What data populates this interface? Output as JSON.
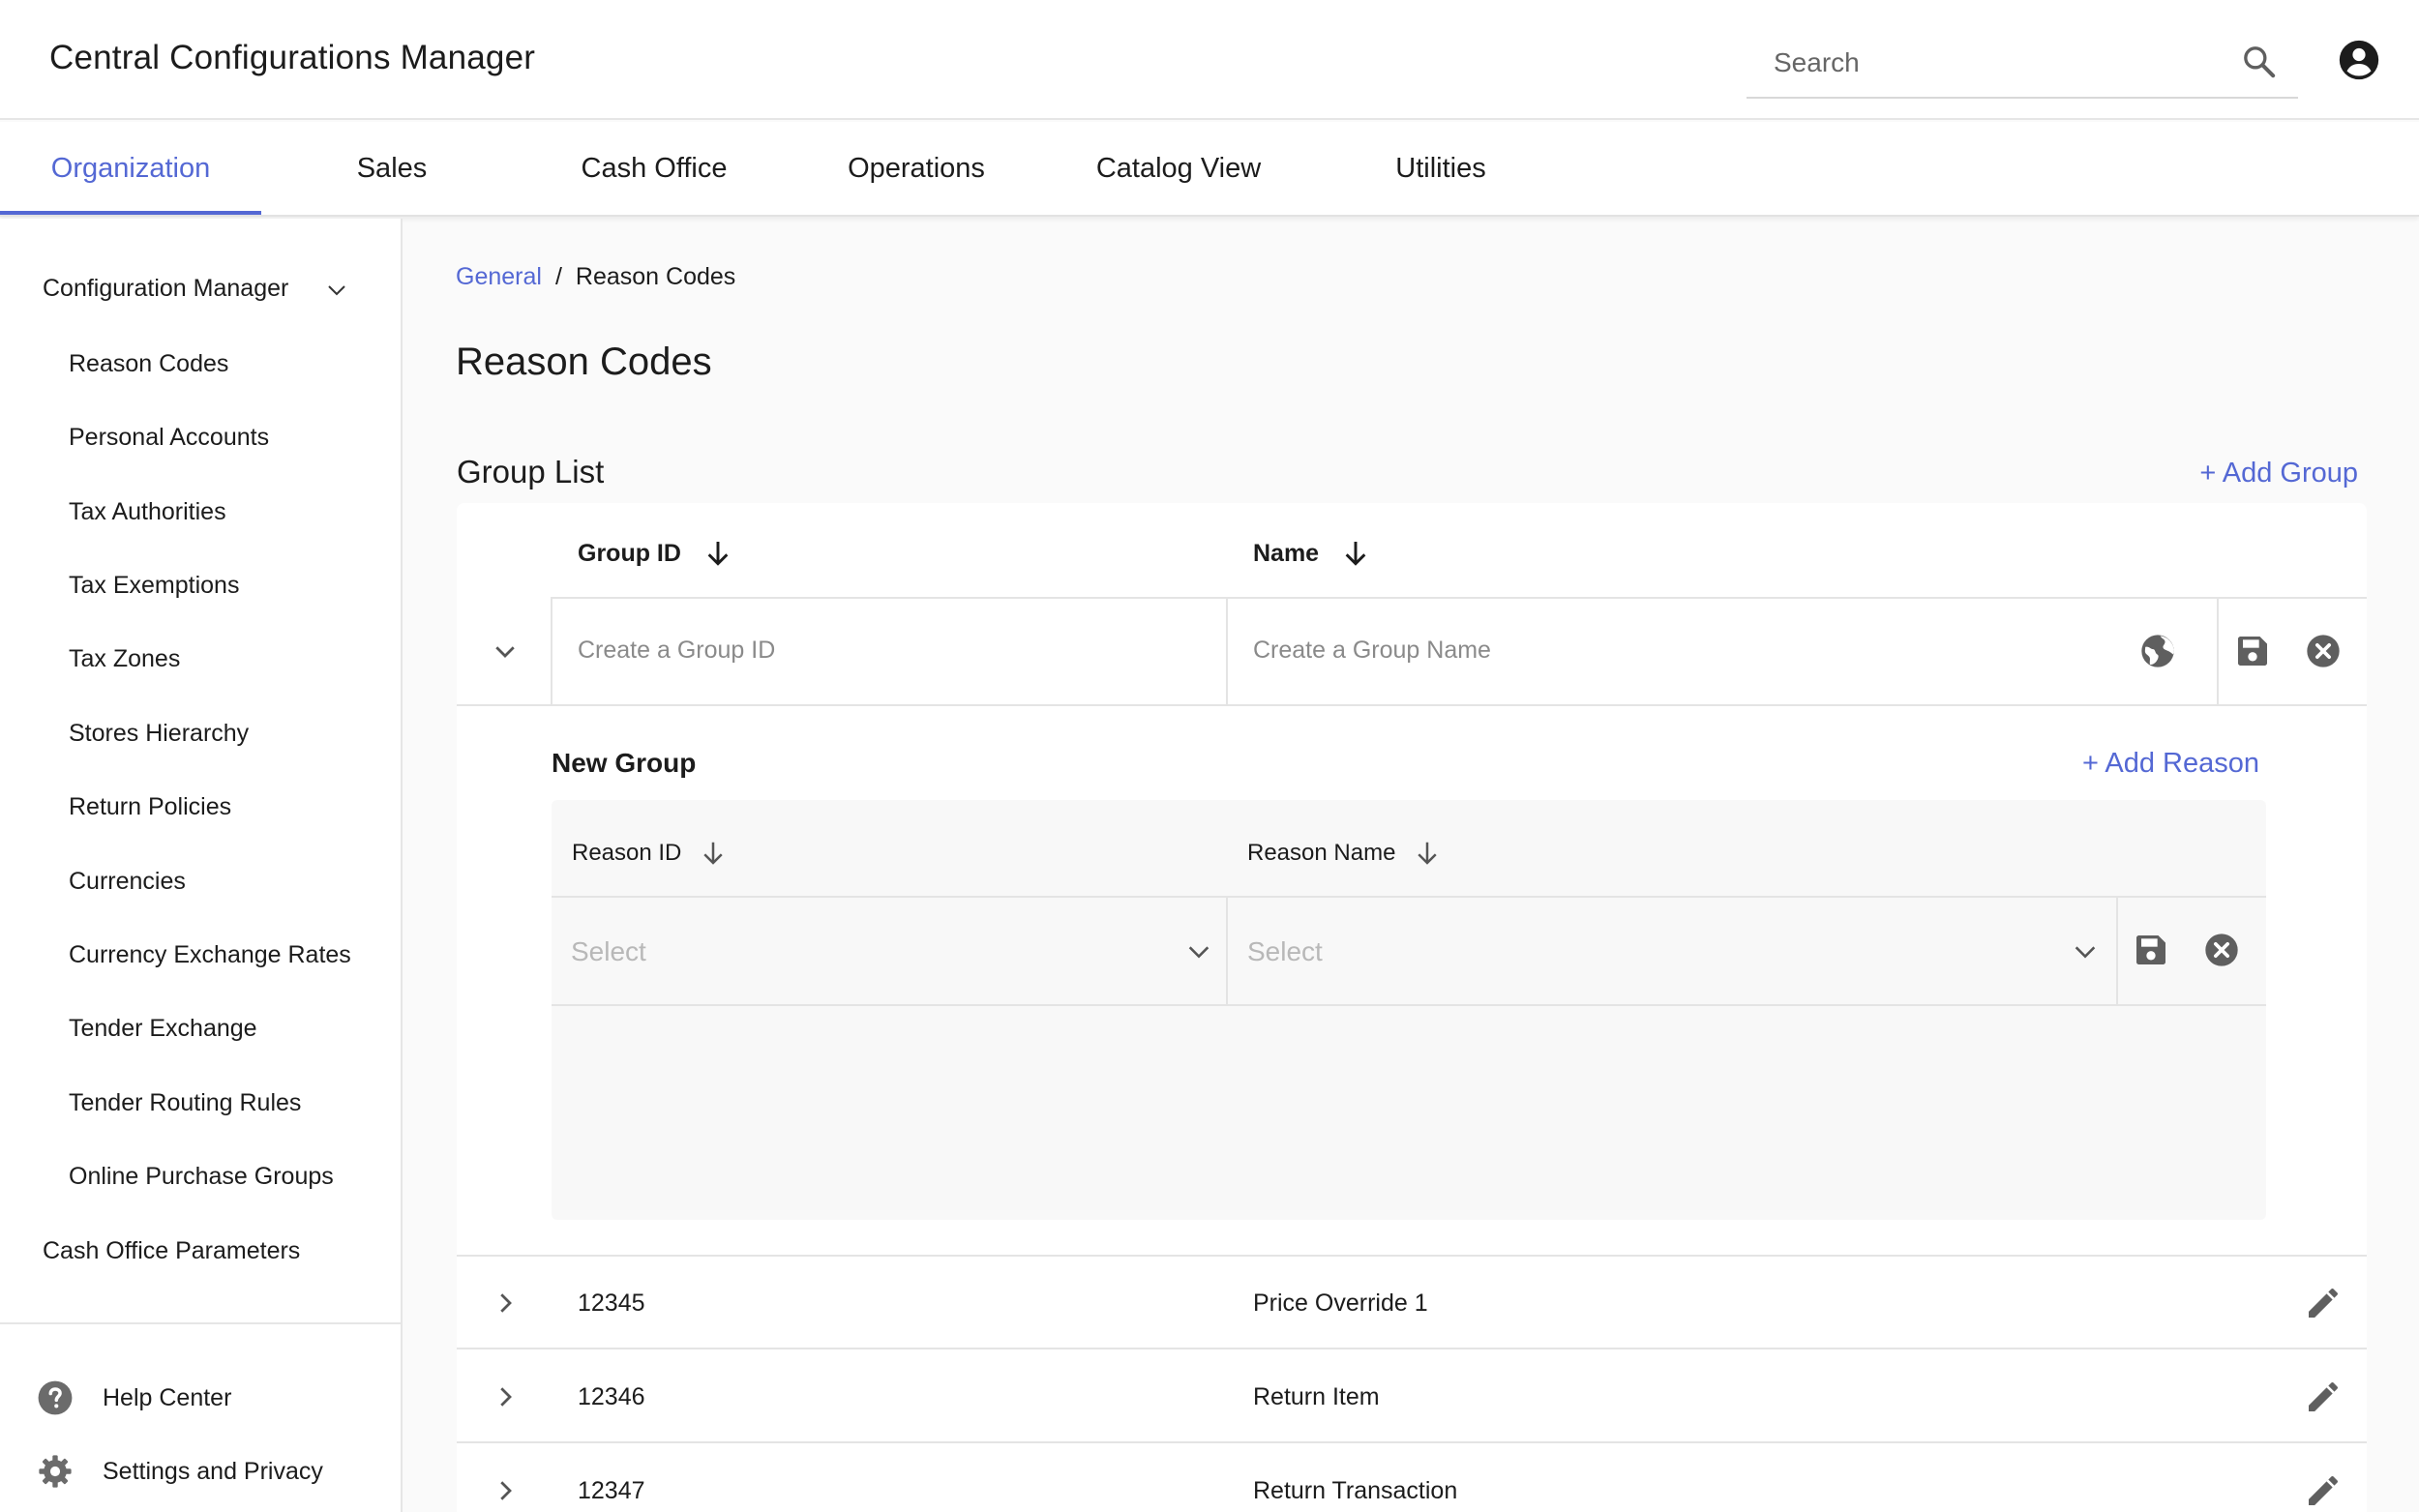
{
  "header": {
    "app_title": "Central Configurations Manager",
    "search_placeholder": "Search"
  },
  "tabs": [
    {
      "label": "Organization",
      "active": true
    },
    {
      "label": "Sales"
    },
    {
      "label": "Cash Office"
    },
    {
      "label": "Operations"
    },
    {
      "label": "Catalog View"
    },
    {
      "label": "Utilities"
    }
  ],
  "sidebar": {
    "group_label": "Configuration Manager",
    "items": [
      "Reason Codes",
      "Personal Accounts",
      "Tax Authorities",
      "Tax Exemptions",
      "Tax Zones",
      "Stores Hierarchy",
      "Return Policies",
      "Currencies",
      "Currency Exchange Rates",
      "Tender Exchange",
      "Tender Routing Rules",
      "Online Purchase Groups"
    ],
    "cash_office": "Cash Office Parameters",
    "footer": {
      "help": "Help Center",
      "settings": "Settings and Privacy"
    }
  },
  "breadcrumb": {
    "parent": "General",
    "separator": "/",
    "current": "Reason Codes"
  },
  "page_title": "Reason Codes",
  "group_list": {
    "title": "Group List",
    "add_group": "+ Add Group",
    "columns": {
      "group_id": "Group ID",
      "name": "Name"
    },
    "new_row": {
      "group_id_placeholder": "Create a Group ID",
      "name_placeholder": "Create a Group Name"
    },
    "new_group": {
      "title": "New Group",
      "add_reason": "+ Add Reason",
      "columns": {
        "reason_id": "Reason ID",
        "reason_name": "Reason Name"
      },
      "reason_id_value": "Select",
      "reason_name_value": "Select"
    },
    "rows": [
      {
        "id": "12345",
        "name": "Price Override 1"
      },
      {
        "id": "12346",
        "name": "Return Item"
      },
      {
        "id": "12347",
        "name": "Return Transaction"
      }
    ]
  },
  "colors": {
    "accent": "#5468d4",
    "icon": "#5f5f5f",
    "border": "#e4e4e4"
  }
}
